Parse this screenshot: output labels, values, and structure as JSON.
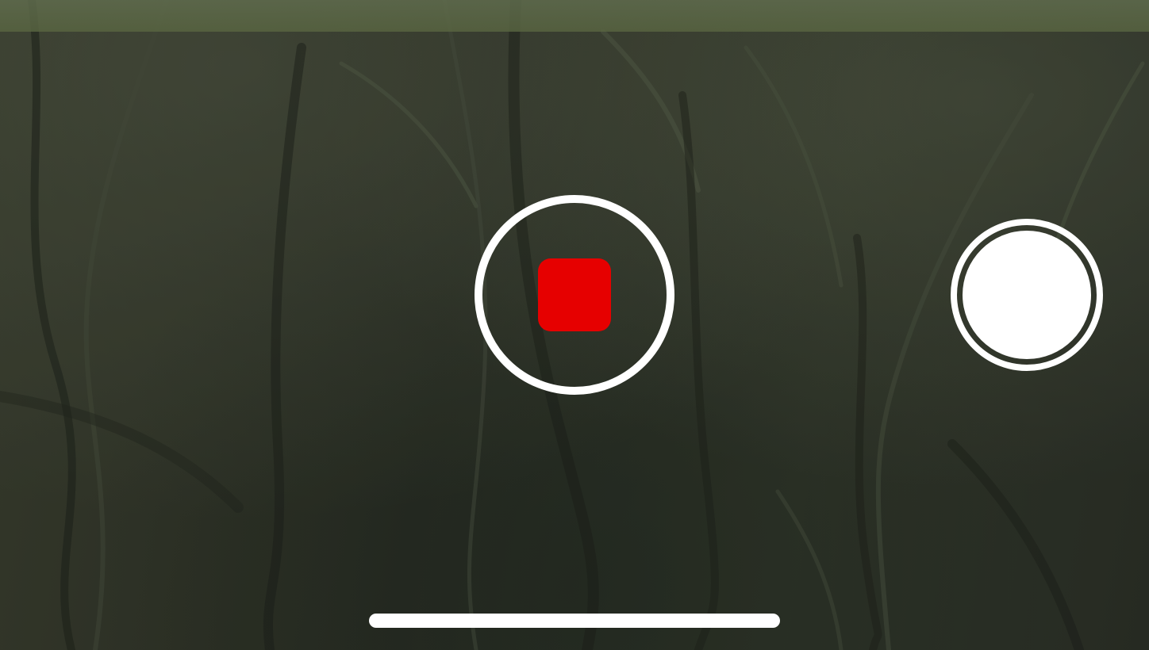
{
  "camera": {
    "mode": "video-recording",
    "controls": {
      "record_button": {
        "state": "recording",
        "icon": "stop-square-icon",
        "ring_color": "#ffffff",
        "stop_color": "#e60000"
      },
      "shutter_button": {
        "icon": "photo-shutter-icon",
        "color": "#ffffff"
      }
    },
    "system": {
      "home_indicator_color": "#ffffff"
    }
  }
}
